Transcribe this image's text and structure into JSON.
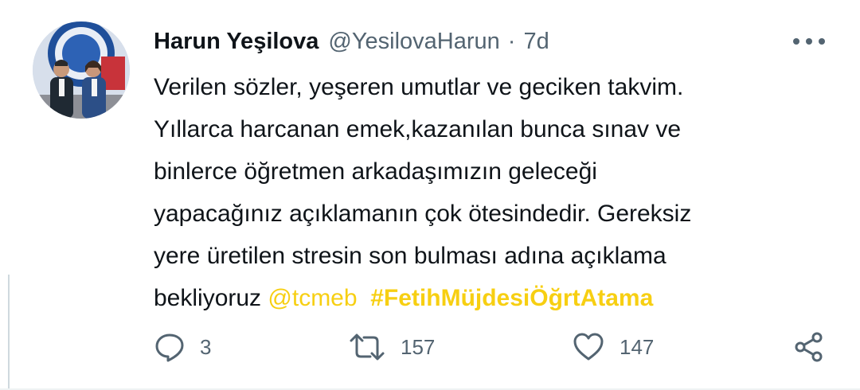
{
  "tweet": {
    "author_name": "Harun Yeşilova",
    "author_handle": "@YesilovaHarun",
    "separator": "·",
    "age": "7d",
    "lines": [
      "Verilen sözler, yeşeren umutlar ve geciken takvim.",
      "Yıllarca harcanan emek,kazanılan bunca sınav ve",
      "binlerce öğretmen arkadaşımızın geleceği",
      "yapacağınız açıklamanın çok ötesindedir. Gereksiz",
      "yere üretilen stresin son bulması adına açıklama"
    ],
    "last_line_text": "bekliyoruz ",
    "mention": "@tcmeb",
    "hashtag": "#FetihMüjdesiÖğrtAtama",
    "link_color": "#f7cf12"
  },
  "actions": {
    "reply_icon": "reply-icon",
    "reply_count": "3",
    "retweet_icon": "retweet-icon",
    "retweet_count": "157",
    "like_icon": "heart-icon",
    "like_count": "147",
    "share_icon": "share-icon"
  },
  "colors": {
    "text": "#0f1419",
    "secondary": "#536471",
    "background": "#ffffff"
  }
}
